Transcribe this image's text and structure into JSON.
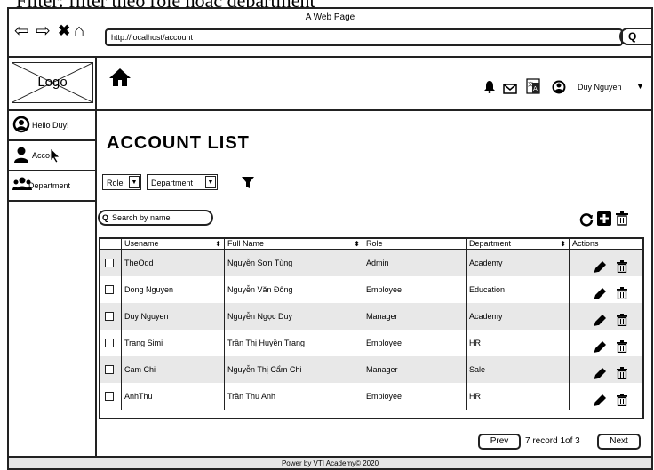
{
  "caption": "Filter: filter theo role hoặc department",
  "window": {
    "title": "A Web Page",
    "url": "http://localhost/account"
  },
  "header": {
    "logo": "Logo",
    "user_name": "Duy Nguyen"
  },
  "sidebar": {
    "items": [
      {
        "label": "Hello Duy!",
        "icon": "user-circle-icon"
      },
      {
        "label": "Account",
        "icon": "user-icon"
      },
      {
        "label": "Department",
        "icon": "users-group-icon"
      }
    ]
  },
  "main": {
    "title": "ACCOUNT LIST",
    "filters": {
      "role": "Role",
      "department": "Department"
    },
    "search_placeholder": "Search by name"
  },
  "table": {
    "columns": [
      "Usename",
      "Full Name",
      "Role",
      "Department",
      "Actions"
    ],
    "rows": [
      {
        "username": "TheOdd",
        "fullname": "Nguyễn Sơn Tùng",
        "role": "Admin",
        "department": "Academy"
      },
      {
        "username": "Dong Nguyen",
        "fullname": "Nguyễn Văn Đông",
        "role": "Employee",
        "department": "Education"
      },
      {
        "username": "Duy Nguyen",
        "fullname": "Nguyễn Ngọc Duy",
        "role": "Manager",
        "department": "Academy"
      },
      {
        "username": "Trang Simi",
        "fullname": "Trần Thị Huyền Trang",
        "role": "Employee",
        "department": "HR"
      },
      {
        "username": "Cam Chi",
        "fullname": "Nguyễn Thị Cẩm Chi",
        "role": "Manager",
        "department": "Sale"
      },
      {
        "username": "AnhThu",
        "fullname": "Trần Thu Anh",
        "role": "Employee",
        "department": "HR"
      }
    ]
  },
  "pagination": {
    "prev": "Prev",
    "info": "7 record 1of 3",
    "next": "Next"
  },
  "footer": "Power by VTI Academy© 2020"
}
